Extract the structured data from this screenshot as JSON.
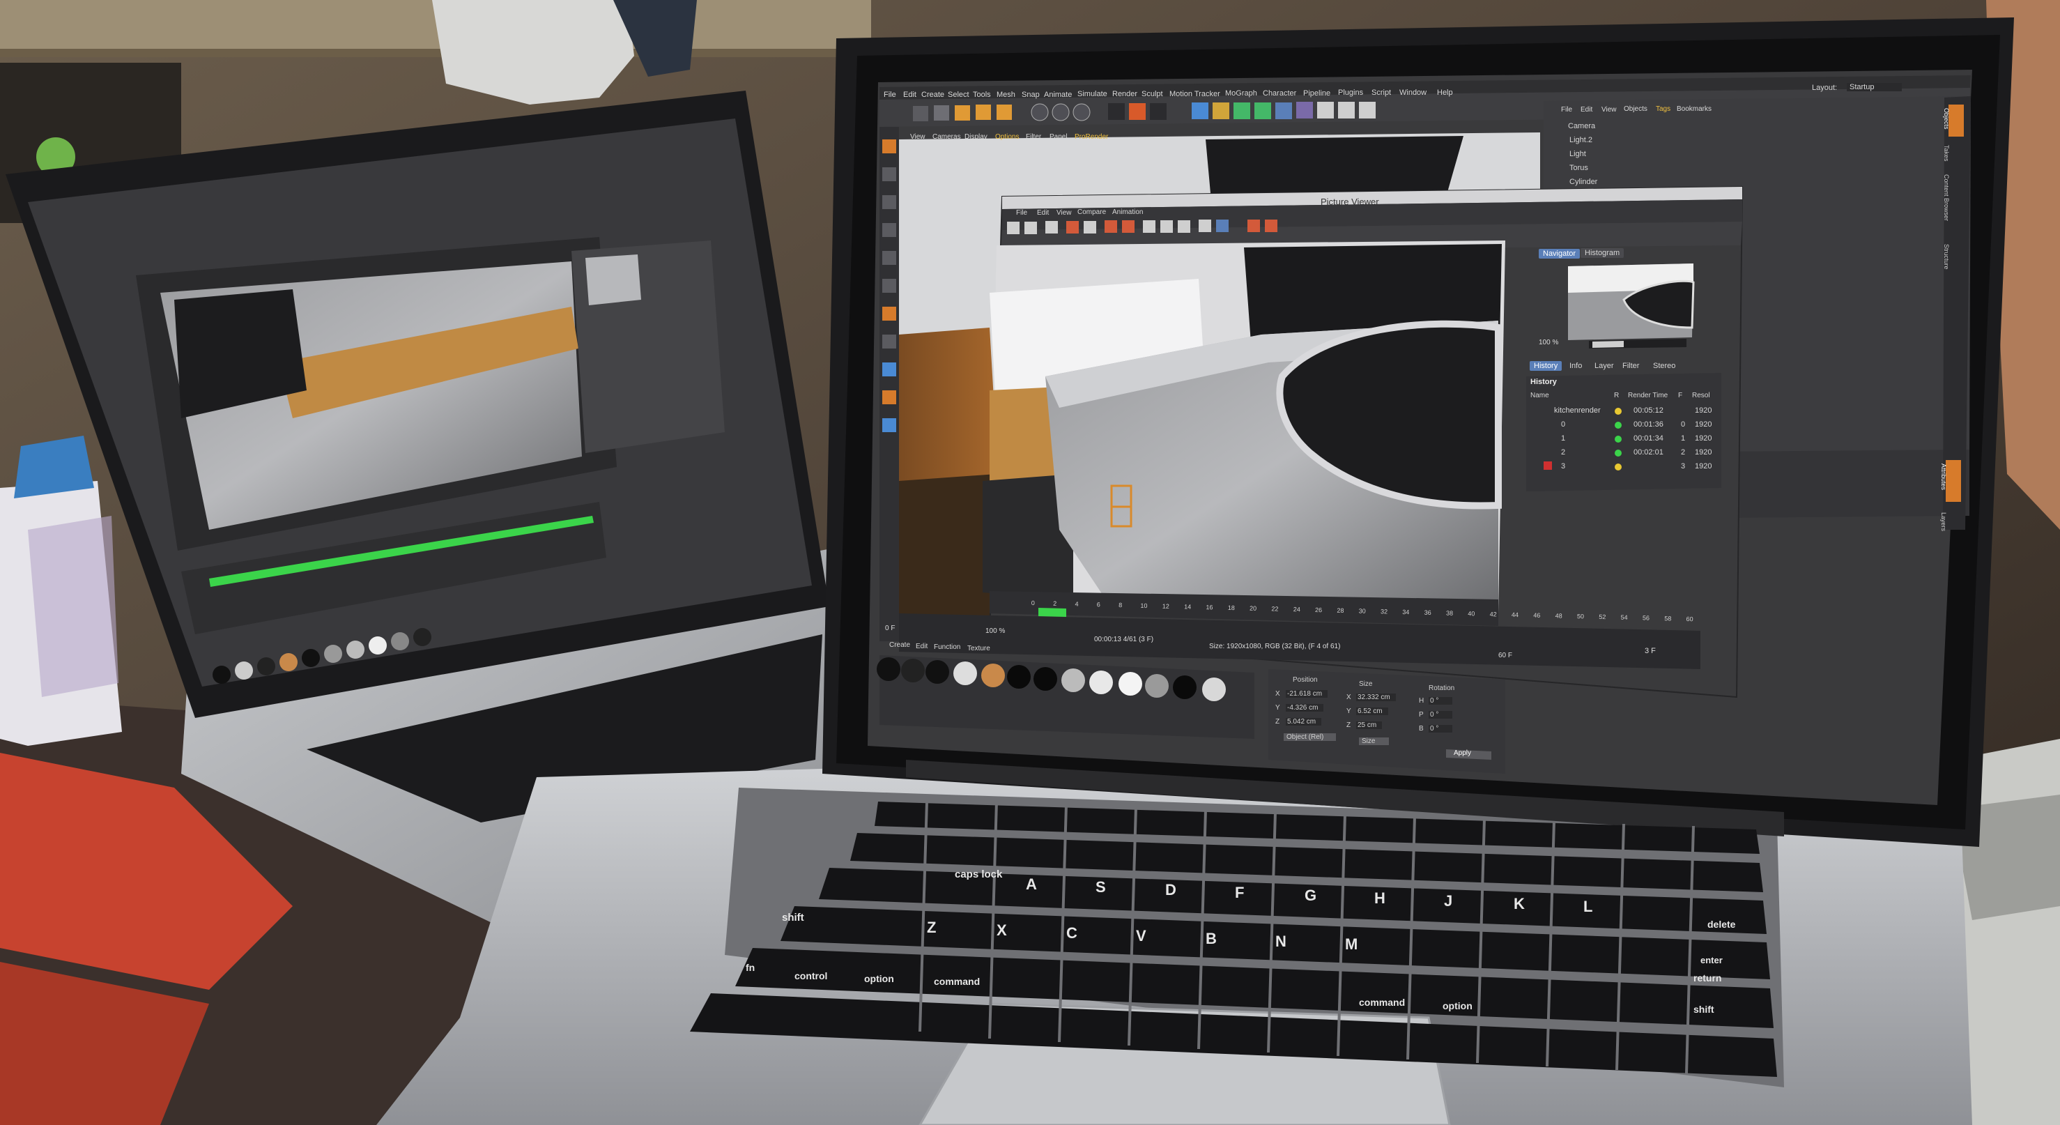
{
  "scene": {
    "description_colors": {
      "wall": "#5a4d40",
      "laptop_body": "#b9bbbe",
      "screen_bezel": "#1a1a1c",
      "c4d_bg": "#3a3a3c",
      "accent_blue": "#5a7fb8",
      "green_dot": "#3bd44a",
      "yellow_dot": "#e8c832",
      "orange_frame": "#d98a2b"
    }
  },
  "right_laptop": {
    "menu": [
      "File",
      "Edit",
      "Create",
      "Select",
      "Tools",
      "Mesh",
      "Snap",
      "Animate",
      "Simulate",
      "Render",
      "Sculpt",
      "Motion Tracker",
      "MoGraph",
      "Character",
      "Pipeline",
      "Plugins",
      "Script",
      "Window",
      "Help"
    ],
    "layout_label": "Layout:",
    "layout_value": "Startup",
    "viewport_menu": [
      "View",
      "Cameras",
      "Display",
      "Options",
      "Filter",
      "Panel",
      "ProRender"
    ],
    "object_manager": {
      "menu": [
        "File",
        "Edit",
        "View",
        "Objects",
        "Tags",
        "Bookmarks"
      ],
      "objects": [
        "Camera",
        "Light.2",
        "Light",
        "Torus",
        "Cylinder"
      ]
    },
    "picture_viewer": {
      "title": "Picture Viewer",
      "menu": [
        "File",
        "Edit",
        "View",
        "Compare",
        "Animation"
      ],
      "tabs_top": [
        "Navigator",
        "Histogram"
      ],
      "zoom": "100 %",
      "tabs_bottom": [
        "History",
        "Info",
        "Layer",
        "Filter",
        "Stereo"
      ],
      "history_label": "History",
      "history_headers": [
        "Name",
        "R",
        "Render Time",
        "F",
        "Resol"
      ],
      "history_rows": [
        {
          "name": "kitchenrender",
          "time": "00:05:12",
          "f": "",
          "res": "1920"
        },
        {
          "name": "0",
          "time": "00:01:36",
          "f": "0",
          "res": "1920"
        },
        {
          "name": "1",
          "time": "00:01:34",
          "f": "1",
          "res": "1920"
        },
        {
          "name": "2",
          "time": "00:02:01",
          "f": "2",
          "res": "1920"
        },
        {
          "name": "3",
          "time": "",
          "f": "3",
          "res": "1920"
        }
      ],
      "status_time": "00:00:13 4/61 (3 F)",
      "status_size": "Size: 1920x1080, RGB (32 Bit), (F 4 of 61)",
      "zoom_bottom": "100 %"
    },
    "timeline": {
      "start": "0 F",
      "end": "60 F",
      "current": "3 F",
      "ticks": [
        "0",
        "2",
        "4",
        "6",
        "8",
        "10",
        "12",
        "14",
        "16",
        "18",
        "20",
        "22",
        "24",
        "26",
        "28",
        "30",
        "32",
        "34",
        "36",
        "38",
        "40",
        "42",
        "44",
        "46",
        "48",
        "50",
        "52",
        "54",
        "56",
        "58",
        "60"
      ]
    },
    "material_tabs": [
      "Create",
      "Edit",
      "Function",
      "Texture"
    ],
    "coordinates": {
      "headers": [
        "Position",
        "Size",
        "Rotation"
      ],
      "rows": [
        {
          "axis": "X",
          "pos": "-21.618 cm",
          "size_axis": "X",
          "size": "32.332 cm",
          "rot_axis": "H",
          "rot": "0 °"
        },
        {
          "axis": "Y",
          "pos": "-4.326 cm",
          "size_axis": "Y",
          "size": "6.52 cm",
          "rot_axis": "P",
          "rot": "0 °"
        },
        {
          "axis": "Z",
          "pos": "5.042 cm",
          "size_axis": "Z",
          "size": "25 cm",
          "rot_axis": "B",
          "rot": "0 °"
        }
      ],
      "mode": "Object (Rel)",
      "size_mode": "Size",
      "apply": "Apply"
    },
    "side_tabs": [
      "Objects",
      "Takes",
      "Content Browser",
      "Structure",
      "Attributes",
      "Layers"
    ]
  },
  "keyboard": {
    "keys_row_a": [
      "caps lock",
      "A",
      "S",
      "D",
      "F",
      "G",
      "H",
      "J",
      "K",
      "L"
    ],
    "keys_row_z": [
      "shift",
      "Z",
      "X",
      "C",
      "V",
      "B",
      "N",
      "M"
    ],
    "keys_row_bottom": [
      "fn",
      "control",
      "option",
      "command",
      "command",
      "option"
    ],
    "keys_right": [
      "delete",
      "return",
      "shift",
      "enter"
    ]
  }
}
